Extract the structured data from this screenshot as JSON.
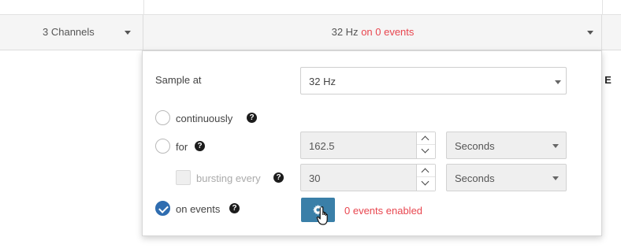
{
  "header": {
    "channels_label": "3 Channels",
    "rate_value": "32 Hz",
    "rate_events": "on 0 events"
  },
  "cutoff_text": "k: E",
  "popup": {
    "sample_at_label": "Sample at",
    "sample_rate": "32 Hz",
    "options": {
      "continuously": {
        "label": "continuously",
        "checked": false
      },
      "for": {
        "label": "for",
        "checked": false,
        "value": "162.5",
        "unit": "Seconds"
      },
      "bursting": {
        "label": "bursting every",
        "checked": false,
        "value": "30",
        "unit": "Seconds"
      },
      "on_events": {
        "label": "on events",
        "checked": true
      }
    },
    "events_enabled_text": "0 events enabled",
    "help_glyph": "?"
  },
  "icons": {
    "gear": "gear-icon",
    "cursor": "hand-pointer-icon",
    "help": "question-circle-icon"
  },
  "colors": {
    "accent": "#2f6db0",
    "button": "#3a7fa8",
    "alert": "#e8464f"
  }
}
